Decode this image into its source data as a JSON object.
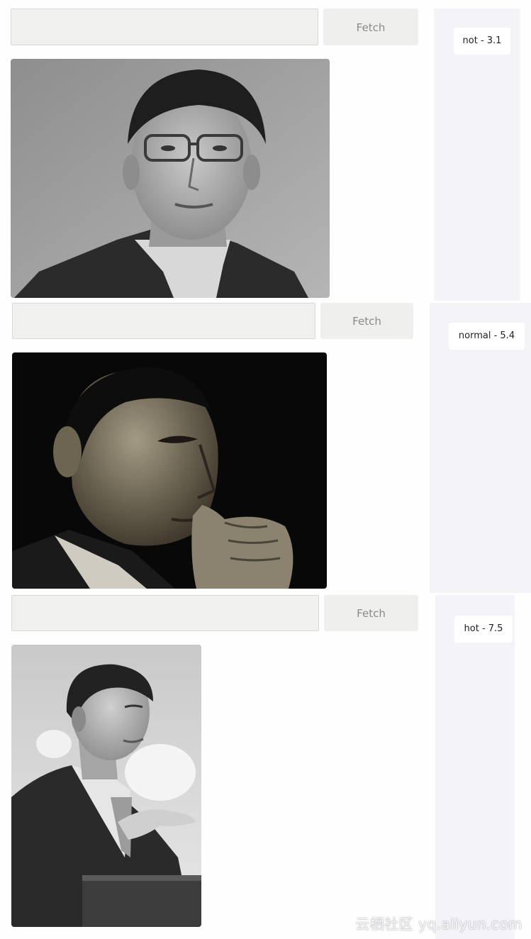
{
  "items": [
    {
      "input_value": "",
      "button_label": "Fetch",
      "result_label": "not - 3.1",
      "photo": {
        "subject": "portrait-man-with-glasses",
        "tone": "grayscale"
      }
    },
    {
      "input_value": "",
      "button_label": "Fetch",
      "result_label": "normal - 5.4",
      "photo": {
        "subject": "portrait-man-hand-on-chin",
        "tone": "dark-monochrome"
      }
    },
    {
      "input_value": "",
      "button_label": "Fetch",
      "result_label": "hot - 7.5",
      "photo": {
        "subject": "man-speaking-at-podium",
        "tone": "grayscale"
      }
    }
  ],
  "watermark": "云栖社区 yq.aliyun.com",
  "colors": {
    "input_bg": "#f0f0ef",
    "button_text": "#8a8a8a",
    "panel_bg": "#f4f3f8",
    "badge_bg": "#ffffff"
  }
}
